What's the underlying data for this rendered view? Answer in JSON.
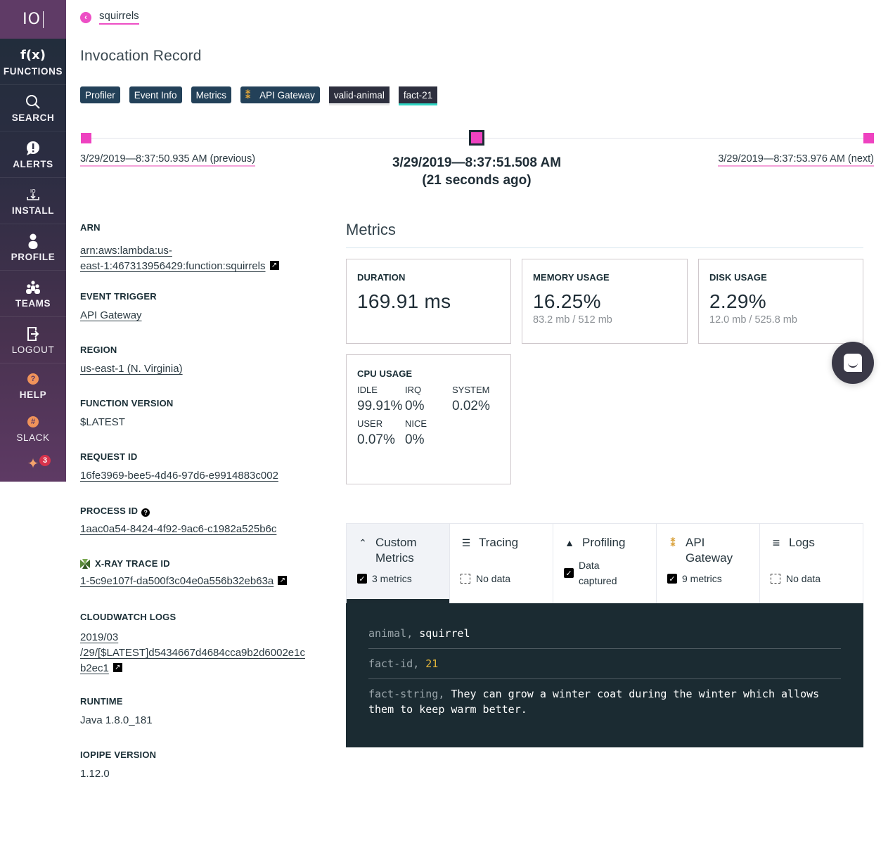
{
  "sidebar": {
    "logo": "IO",
    "items": [
      {
        "icon": "function-icon",
        "glyph": "f(x)",
        "label": "FUNCTIONS"
      },
      {
        "icon": "search-icon",
        "label": "SEARCH"
      },
      {
        "icon": "alert-icon",
        "label": "ALERTS"
      },
      {
        "icon": "install-icon",
        "label": "INSTALL"
      },
      {
        "icon": "profile-icon",
        "label": "PROFILE"
      },
      {
        "icon": "teams-icon",
        "label": "TEAMS"
      },
      {
        "icon": "logout-icon",
        "label": "LOGOUT"
      },
      {
        "icon": "help-icon",
        "glyph": "?",
        "label": "HELP"
      },
      {
        "icon": "slack-icon",
        "glyph": "#",
        "label": "SLACK"
      }
    ],
    "whats_new_count": "3"
  },
  "header": {
    "back_label": "squirrels",
    "title": "Invocation Record",
    "tags": [
      {
        "label": "Profiler"
      },
      {
        "label": "Event Info"
      },
      {
        "label": "Metrics"
      },
      {
        "label": "API Gateway"
      }
    ],
    "labels": [
      {
        "label": "valid-animal",
        "active": false
      },
      {
        "label": "fact-21",
        "active": true
      }
    ]
  },
  "timeline": {
    "previous": "3/29/2019—8:37:50.935 AM (previous)",
    "current_time": "3/29/2019—8:37:51.508 AM",
    "current_ago": "(21 seconds ago)",
    "next": "3/29/2019—8:37:53.976 AM (next)"
  },
  "details": {
    "arn_label": "ARN",
    "arn_line1": "arn:aws:lambda:us-",
    "arn_line2": "east-1:467313956429:function:squirrels",
    "event_trigger_label": "EVENT TRIGGER",
    "event_trigger": "API Gateway",
    "region_label": "REGION",
    "region": "us-east-1 (N. Virginia)",
    "function_version_label": "FUNCTION VERSION",
    "function_version": "$LATEST",
    "request_id_label": "REQUEST ID",
    "request_id": "16fe3969-bee5-4d46-97d6-e9914883c002",
    "process_id_label": "PROCESS ID",
    "process_id": "1aac0a54-8424-4f92-9ac6-c1982a525b6c",
    "xray_label": "X-RAY TRACE ID",
    "xray_id": "1-5c9e107f-da500f3c04e0a556b32eb63a",
    "cloudwatch_label": "CLOUDWATCH LOGS",
    "cloudwatch_line1": "2019/03",
    "cloudwatch_line2": "/29/[$LATEST]d5434667d4684cca9b2d6002e1c",
    "cloudwatch_line3": "b2ec1",
    "runtime_label": "RUNTIME",
    "runtime": "Java 1.8.0_181",
    "iopipe_version_label": "IOPIPE VERSION",
    "iopipe_version": "1.12.0"
  },
  "metrics": {
    "title": "Metrics",
    "duration": {
      "label": "DURATION",
      "value": "169.91 ms"
    },
    "memory": {
      "label": "MEMORY USAGE",
      "value": "16.25%",
      "sub": "83.2 mb / 512 mb"
    },
    "disk": {
      "label": "DISK USAGE",
      "value": "2.29%",
      "sub": "12.0 mb / 525.8 mb"
    },
    "cpu": {
      "label": "CPU USAGE",
      "idle_label": "IDLE",
      "idle": "99.91%",
      "irq_label": "IRQ",
      "irq": "0%",
      "system_label": "SYSTEM",
      "system": "0.02%",
      "user_label": "USER",
      "user": "0.07%",
      "nice_label": "NICE",
      "nice": "0%"
    }
  },
  "tabs": [
    {
      "label_line1": "Custom",
      "label_line2": "Metrics",
      "status": "3 metrics",
      "captured": true,
      "active": true
    },
    {
      "label_line1": "Tracing",
      "status": "No data",
      "captured": false
    },
    {
      "label_line1": "Profiling",
      "status_line1": "Data",
      "status_line2": "captured",
      "captured": true
    },
    {
      "label_line1": "API",
      "label_line2": "Gateway",
      "status": "9 metrics",
      "captured": true
    },
    {
      "label_line1": "Logs",
      "status": "No data",
      "captured": false
    }
  ],
  "custom_metrics": [
    {
      "key": "animal",
      "value": "squirrel",
      "type": "string"
    },
    {
      "key": "fact-id",
      "value": "21",
      "type": "number"
    },
    {
      "key": "fact-string",
      "value": "They can grow a winter coat during the winter which allows them to keep warm better.",
      "type": "string"
    }
  ],
  "colors": {
    "accent_pink": "#ee42c0",
    "navy_tag": "#234159",
    "label_dark": "#2d2f3e",
    "active_label_underline": "#2fd6c3",
    "panel_bg": "#1b2b32",
    "number_highlight": "#e2b53b"
  }
}
